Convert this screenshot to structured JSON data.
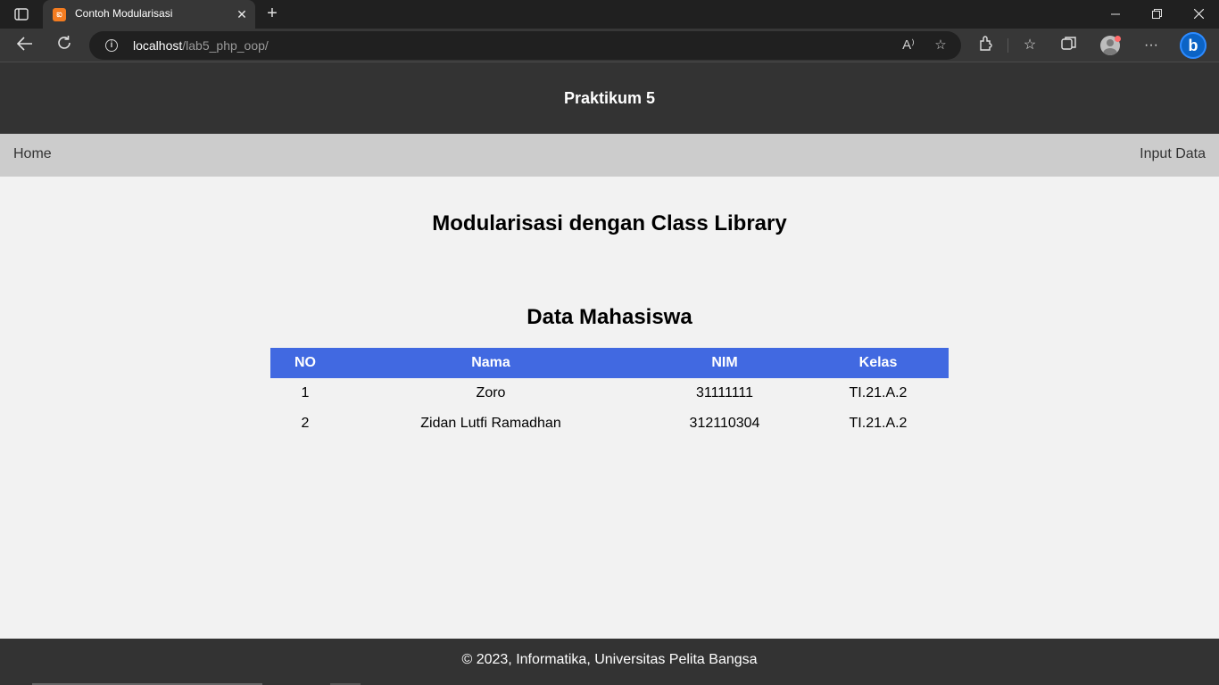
{
  "browser": {
    "tab": {
      "title": "Contoh Modularisasi",
      "favicon": "xampp-icon"
    },
    "address": {
      "host": "localhost",
      "path": "/lab5_php_oop/"
    },
    "icons": {
      "tab_actions": "tab-actions-icon",
      "back": "back-arrow-icon",
      "refresh": "refresh-icon",
      "info": "info-icon",
      "read_aloud": "read-aloud-icon",
      "add_favorite": "add-favorite-icon",
      "extensions": "extensions-icon",
      "favorites": "favorites-icon",
      "collections": "collections-icon",
      "profile": "profile-avatar-icon",
      "more": "more-icon",
      "copilot": "bing-copilot-icon"
    }
  },
  "page": {
    "header_title": "Praktikum 5",
    "nav": {
      "home": "Home",
      "input": "Input Data"
    },
    "main_heading": "Modularisasi dengan Class Library",
    "section_heading": "Data Mahasiswa",
    "table": {
      "columns": [
        "NO",
        "Nama",
        "NIM",
        "Kelas"
      ],
      "rows": [
        {
          "no": "1",
          "nama": "Zoro",
          "nim": "31111111",
          "kelas": "TI.21.A.2"
        },
        {
          "no": "2",
          "nama": "Zidan Lutfi Ramadhan",
          "nim": "312110304",
          "kelas": "TI.21.A.2"
        }
      ]
    },
    "footer": "© 2023, Informatika, Universitas Pelita Bangsa"
  },
  "colors": {
    "header_bg": "#333333",
    "nav_bg": "#cccccc",
    "table_header_bg": "#4169e1",
    "page_bg": "#f2f2f2"
  }
}
